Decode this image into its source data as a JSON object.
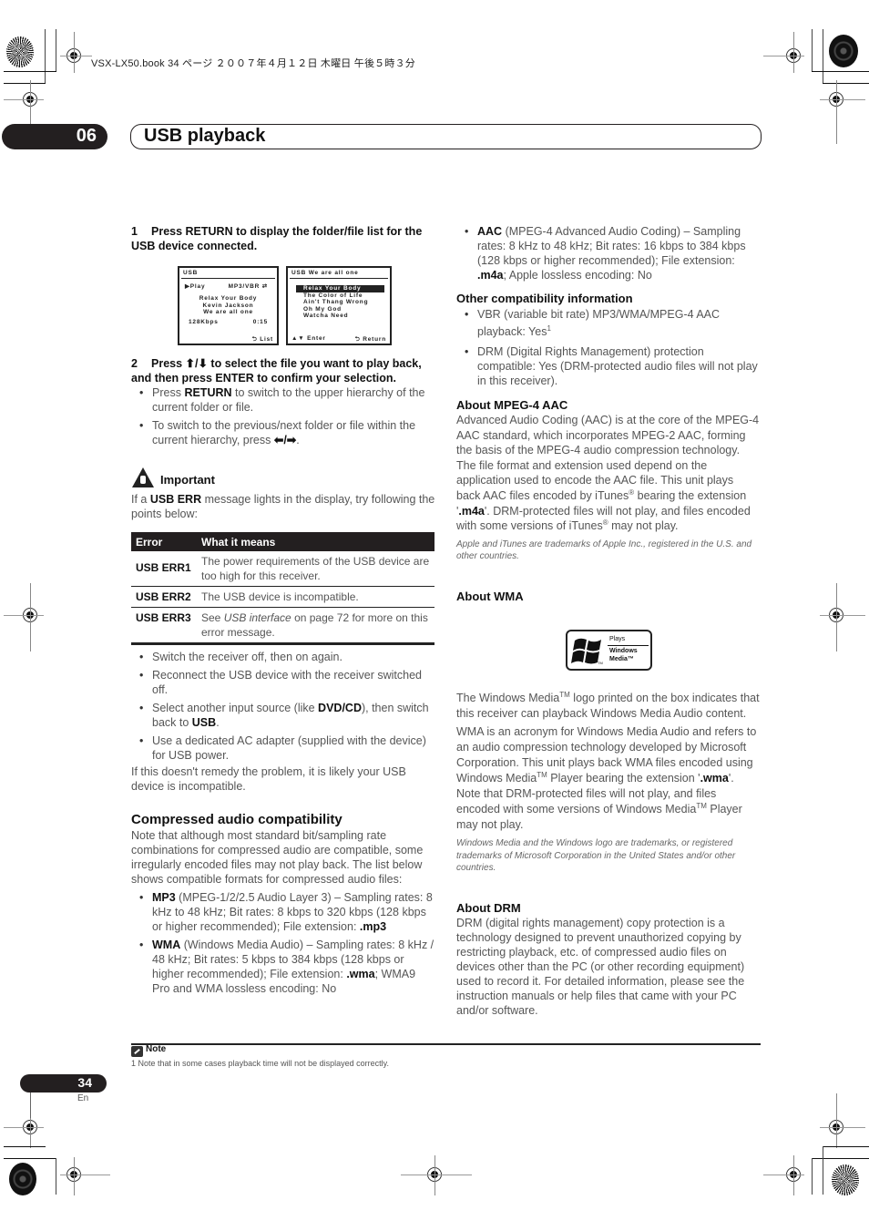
{
  "book_line": "VSX-LX50.book  34 ページ  ２００７年４月１２日  木曜日  午後５時３分",
  "header": {
    "chapter_number": "06",
    "title": "USB playback"
  },
  "step1": {
    "number": "1",
    "text": "Press RETURN to display the folder/file list for the USB device connected."
  },
  "lcd_play": {
    "header": "USB",
    "status": "▶Play",
    "format": "MP3/VBR ⇄",
    "track": "Relax Your Body",
    "artist": "Kevin Jackson",
    "album": "We are all one",
    "bitrate": "128Kbps",
    "time": "0:15",
    "footer": "⮌ List"
  },
  "lcd_list": {
    "header": "USB  We are all one",
    "items": [
      "Relax Your Body",
      "The Color of Life",
      "Ain't Thang Wrong",
      "Oh My God",
      "Watcha Need"
    ],
    "selected_index": 0,
    "footer_left": "▲▼ Enter",
    "footer_right": "⮌ Return"
  },
  "step2": {
    "number": "2",
    "text_a": "Press ",
    "arrows": "⬆/⬇",
    "text_b": " to select the file you want to play back, and then press ENTER to confirm your selection.",
    "bullets": [
      {
        "pre": "Press ",
        "bold": "RETURN",
        "post": " to switch to the upper hierarchy of the current folder or file."
      },
      {
        "pre": "To switch to the previous/next folder or file within the current hierarchy, press ",
        "bold": "⬅/➡",
        "post": "."
      }
    ]
  },
  "important": {
    "title": "Important",
    "intro_pre": "If a ",
    "intro_bold": "USB ERR",
    "intro_post": " message lights in the display, try following the points below:"
  },
  "error_table": {
    "headers": [
      "Error",
      "What it means"
    ],
    "rows": [
      {
        "code": "USB ERR1",
        "meaning": "The power requirements of the USB device are too high for this receiver."
      },
      {
        "code": "USB ERR2",
        "meaning": "The USB device is incompatible."
      },
      {
        "code": "USB ERR3",
        "meaning_pre": "See ",
        "meaning_italic": "USB interface",
        "meaning_post": " on page 72 for more on this error message."
      }
    ]
  },
  "remedies": [
    {
      "text": "Switch the receiver off, then on again."
    },
    {
      "text": "Reconnect the USB device with the receiver switched off."
    },
    {
      "pre": "Select another input source (like ",
      "bold1": "DVD/CD",
      "mid": "), then switch back to ",
      "bold2": "USB",
      "post": "."
    },
    {
      "text": "Use a dedicated AC adapter (supplied with the device) for USB power."
    }
  ],
  "remedy_footer": "If this doesn't remedy the problem, it is likely your USB device is incompatible.",
  "compressed": {
    "heading": "Compressed audio compatibility",
    "intro": "Note that although most standard bit/sampling rate combinations for compressed audio are compatible, some irregularly encoded files may not play back. The list below shows compatible formats for compressed audio files:",
    "formats": [
      {
        "name": "MP3",
        "desc": " (MPEG-1/2/2.5 Audio Layer 3) – Sampling rates: 8 kHz to 48 kHz; Bit rates: 8 kbps to 320 kbps (128 kbps or higher recommended); File extension: ",
        "ext": ".mp3",
        "tail": ""
      },
      {
        "name": "WMA",
        "desc": " (Windows Media Audio) – Sampling rates: 8 kHz / 48 kHz; Bit rates: 5 kbps to 384 kbps (128 kbps or higher recommended); File extension: ",
        "ext": ".wma",
        "tail": "; WMA9 Pro and WMA lossless encoding: No"
      },
      {
        "name": "AAC",
        "desc": " (MPEG-4 Advanced Audio Coding) – Sampling rates: 8 kHz to 48 kHz; Bit rates: 16 kbps to 384 kbps (128 kbps or higher recommended); File extension: ",
        "ext": ".m4a",
        "tail": "; Apple lossless encoding: No"
      }
    ]
  },
  "other": {
    "heading": "Other compatibility information",
    "bullets": [
      {
        "text": "VBR (variable bit rate) MP3/WMA/MPEG-4 AAC playback: Yes",
        "sup": "1"
      },
      {
        "text": "DRM (Digital Rights Management) protection compatible: Yes (DRM-protected audio files will not play in this receiver)."
      }
    ]
  },
  "aac": {
    "heading": "About MPEG-4 AAC",
    "p1": "Advanced Audio Coding (AAC) is at the core of the MPEG-4 AAC standard, which incorporates MPEG-2 AAC, forming the basis of the MPEG-4 audio compression technology. The file format and extension used depend on the application used to encode the AAC file. This unit plays back AAC files encoded by iTunes",
    "reg": "®",
    "p2": " bearing the extension '",
    "ext": ".m4a",
    "p3": "'. DRM-protected files will not play, and files encoded with some versions of iTunes",
    "p4": " may not play.",
    "trademark": "Apple and iTunes are trademarks of Apple Inc., registered in the U.S. and other countries."
  },
  "wma": {
    "heading": "About WMA",
    "logo": {
      "top": "Plays",
      "line1": "Windows",
      "line2": "Media™",
      "tm": "TM"
    },
    "p1a": "The Windows Media",
    "tm": "TM",
    "p1b": " logo printed on the box indicates that this receiver can playback Windows Media Audio content.",
    "p2a": "WMA is an acronym for Windows Media Audio and refers to an audio compression technology developed by Microsoft Corporation. This unit plays back WMA files encoded using Windows Media",
    "p2b": " Player bearing the extension '",
    "ext": ".wma",
    "p2c": "'. Note that DRM-protected files will not play, and files encoded with some versions of Windows Media",
    "p2d": " Player may not play.",
    "trademark": "Windows Media and the Windows logo are trademarks, or registered trademarks of Microsoft Corporation in the United States and/or other countries."
  },
  "drm": {
    "heading": "About DRM",
    "text": "DRM (digital rights management) copy protection is a technology designed to prevent unauthorized copying by restricting playback, etc. of compressed audio files on devices other than the PC (or other recording equipment) used to record it. For detailed information, please see the instruction manuals or help files that came with your PC and/or software."
  },
  "note": {
    "title": "Note",
    "text": "1 Note that in some cases playback time will not be displayed correctly."
  },
  "footer": {
    "page_number": "34",
    "language": "En"
  }
}
